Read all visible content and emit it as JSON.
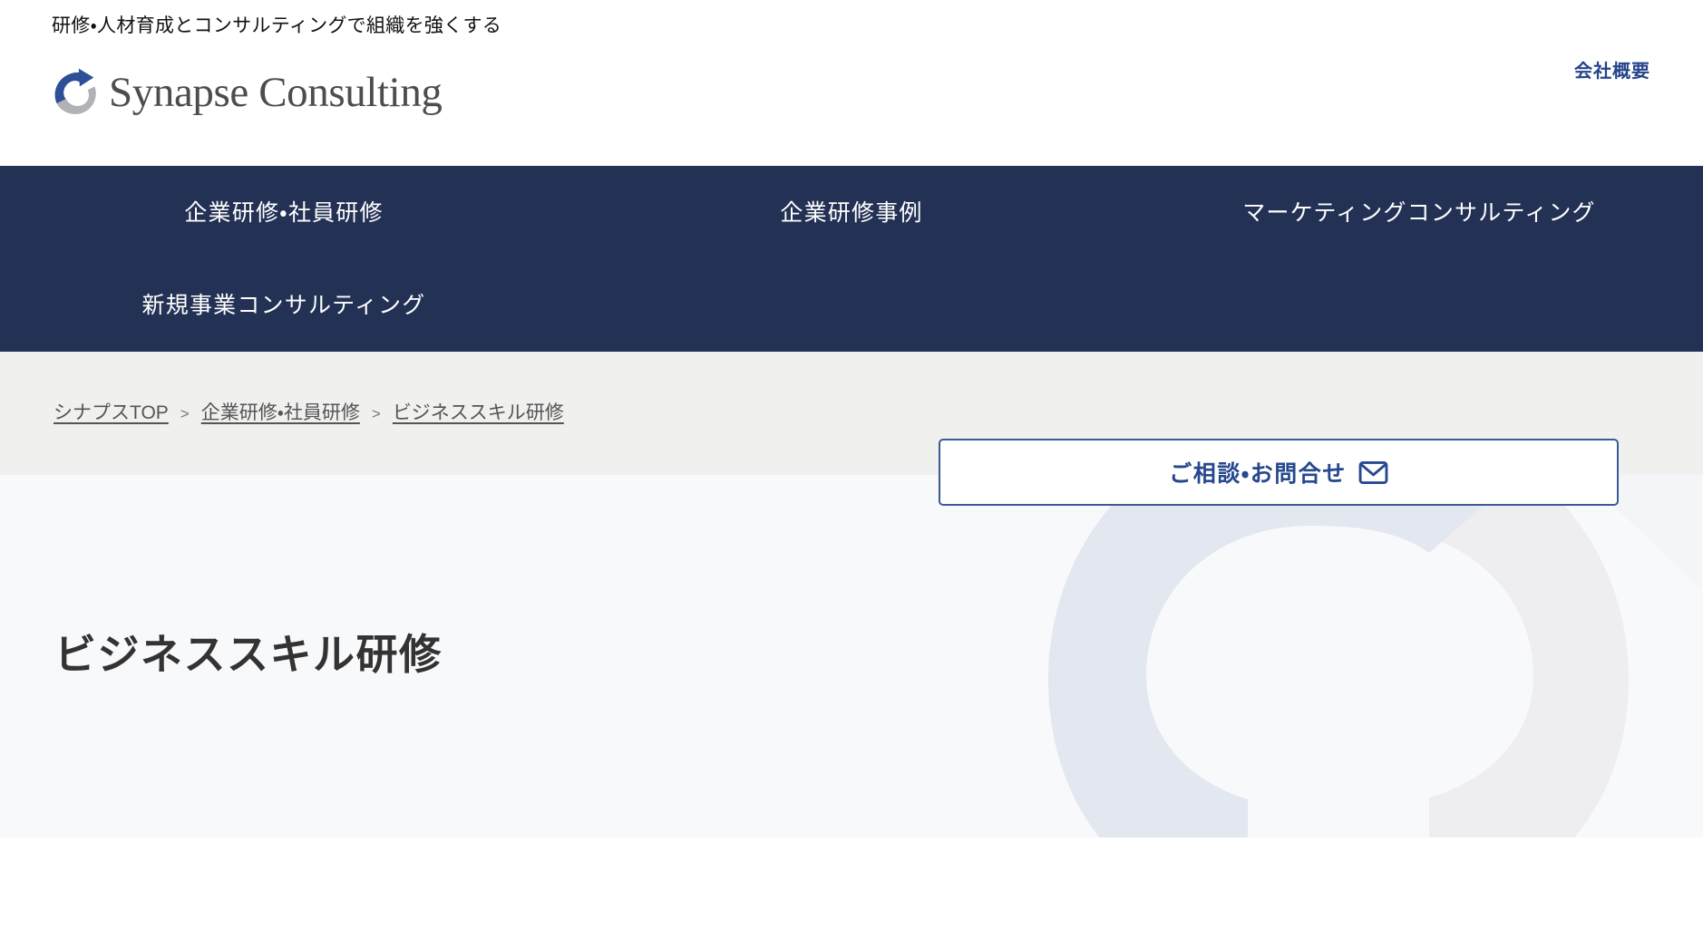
{
  "header": {
    "tagline": "研修・人材育成とコンサルティングで組織を強くする",
    "brand_name": "Synapse Consulting",
    "brand_mark_icon": "synapse-swoosh-logo-icon",
    "company_link": "会社概要"
  },
  "nav": {
    "items": [
      {
        "label": "企業研修・社員研修"
      },
      {
        "label": "企業研修事例"
      },
      {
        "label": "マーケティングコンサルティング"
      },
      {
        "label": "新規事業コンサルティング"
      }
    ],
    "contact_button": {
      "label": "ご相談・お問合せ",
      "icon": "mail-envelope-icon"
    }
  },
  "breadcrumb": {
    "separator": ">",
    "items": [
      {
        "label": "シナプスTOP"
      },
      {
        "label": "企業研修・社員研修"
      },
      {
        "label": "ビジネススキル研修"
      }
    ]
  },
  "hero": {
    "title": "ビジネススキル研修",
    "watermark_icon": "synapse-swoosh-watermark-icon"
  },
  "colors": {
    "navy": "#233154",
    "brand_blue": "#26488e",
    "breadcrumb_band": "#f0f0ef",
    "hero_bg": "#f8f9fb",
    "watermark_blue": "#e2e7f0",
    "watermark_gray": "#eeeef0",
    "logo_blue": "#2d4f98",
    "logo_gray": "#b0b2b5",
    "title_text": "#333333"
  }
}
